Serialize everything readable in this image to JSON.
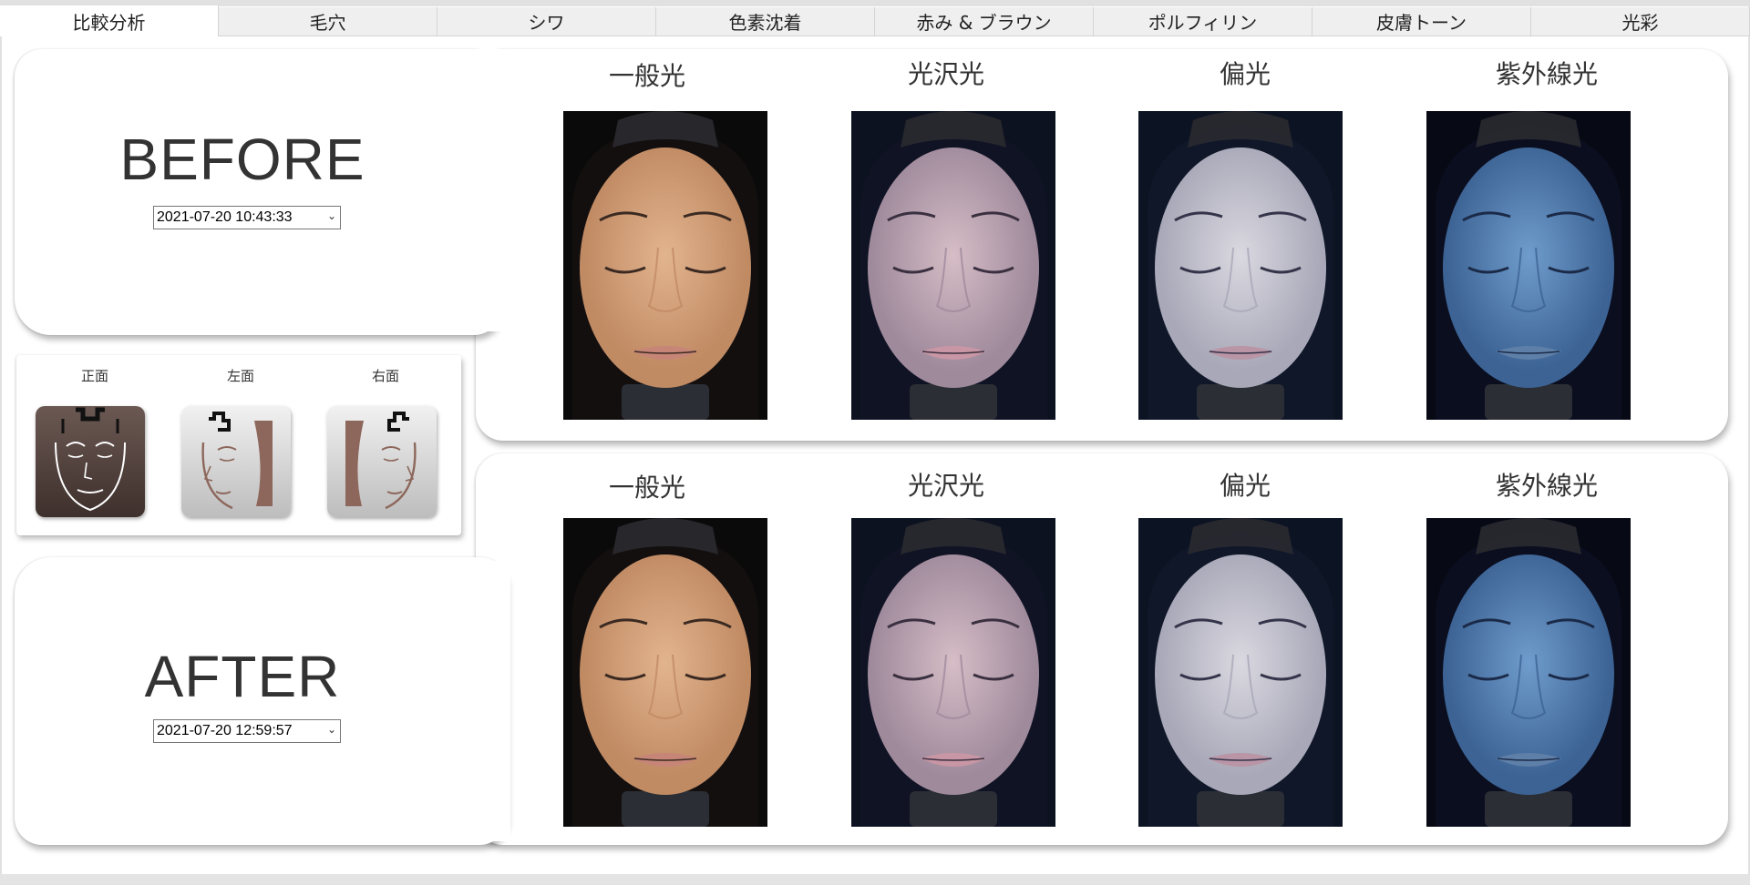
{
  "tabs": [
    {
      "label": "比較分析",
      "active": true
    },
    {
      "label": "毛穴"
    },
    {
      "label": "シワ"
    },
    {
      "label": "色素沈着"
    },
    {
      "label": "赤み & ブラウン"
    },
    {
      "label": "ポルフィリン"
    },
    {
      "label": "皮膚トーン"
    },
    {
      "label": "光彩"
    }
  ],
  "before": {
    "title": "BEFORE",
    "date": "2021-07-20 10:43:33",
    "columns": [
      "一般光",
      "光沢光",
      "偏光",
      "紫外線光"
    ]
  },
  "after": {
    "title": "AFTER",
    "date": "2021-07-20 12:59:57",
    "columns": [
      "一般光",
      "光沢光",
      "偏光",
      "紫外線光"
    ]
  },
  "views": {
    "front": "正面",
    "left": "左面",
    "right": "右面"
  },
  "colors": {
    "normal_skin": "#e2b48e",
    "gloss_skin": "#d6bdc6",
    "polar_skin": "#dad8e0",
    "uv_skin": "#6f9ccc",
    "active_view": "#5a4944",
    "inactive_view": "#dadada"
  }
}
